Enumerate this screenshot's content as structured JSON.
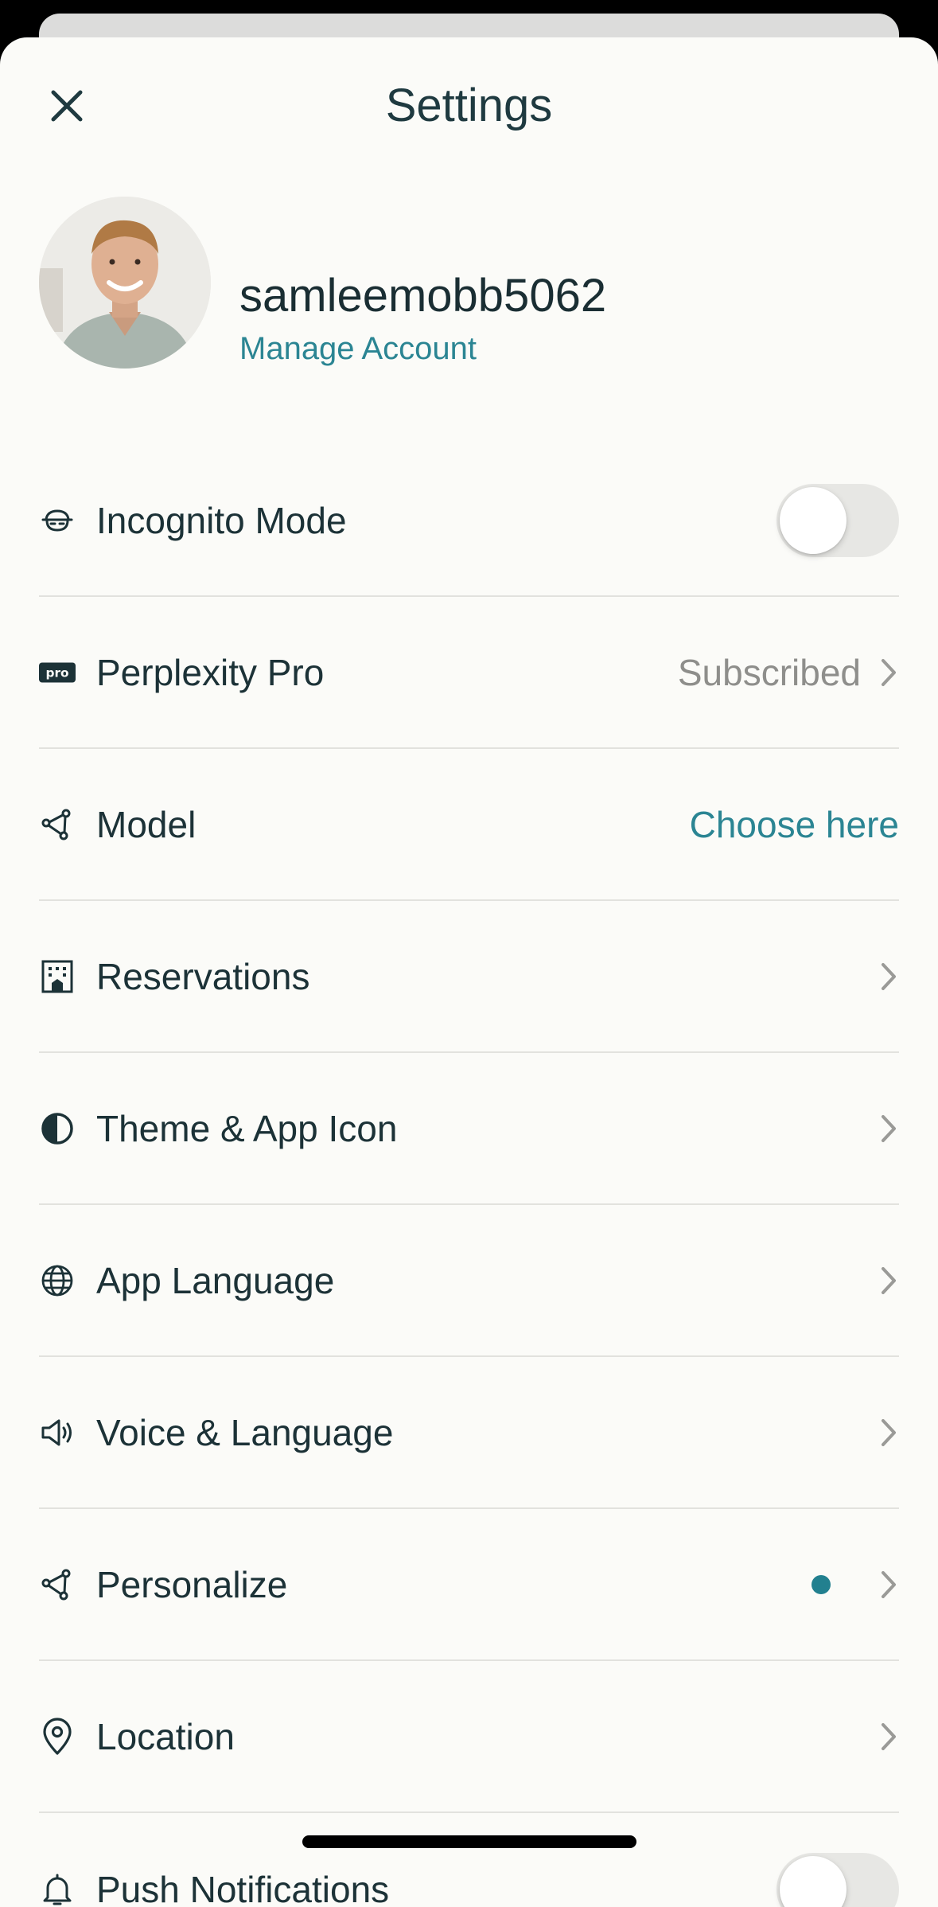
{
  "header": {
    "title": "Settings",
    "close_icon": "close-icon"
  },
  "profile": {
    "username": "samleemobb5062",
    "manage_label": "Manage Account",
    "avatar_icon": "avatar"
  },
  "colors": {
    "accent": "#2b8593",
    "text": "#1c3237",
    "muted": "#8e8e8b",
    "background": "#fbfbf8",
    "divider": "#e2e2de"
  },
  "rows": [
    {
      "label": "Incognito Mode",
      "icon": "incognito-icon",
      "control": "toggle",
      "on": false
    },
    {
      "label": "Perplexity Pro",
      "icon": "pro-badge-icon",
      "value": "Subscribed",
      "control": "chevron"
    },
    {
      "label": "Model",
      "icon": "model-icon",
      "value": "Choose here",
      "control": "link"
    },
    {
      "label": "Reservations",
      "icon": "building-icon",
      "control": "chevron"
    },
    {
      "label": "Theme & App Icon",
      "icon": "theme-icon",
      "control": "chevron"
    },
    {
      "label": "App Language",
      "icon": "globe-icon",
      "control": "chevron"
    },
    {
      "label": "Voice & Language",
      "icon": "speaker-icon",
      "control": "chevron"
    },
    {
      "label": "Personalize",
      "icon": "personalize-icon",
      "control": "chevron",
      "badge_dot": true
    },
    {
      "label": "Location",
      "icon": "location-pin-icon",
      "control": "chevron"
    },
    {
      "label": "Push Notifications",
      "icon": "bell-icon",
      "control": "toggle",
      "on": false
    }
  ]
}
